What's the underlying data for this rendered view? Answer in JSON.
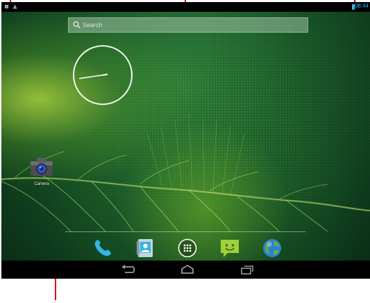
{
  "status_bar": {
    "time": "08:44",
    "colors": {
      "accent": "#33b5e5"
    }
  },
  "search": {
    "placeholder": "Search"
  },
  "clock": {
    "time_shown": "8:44"
  },
  "desktop_icons": [
    {
      "label": "Camera",
      "icon": "camera-icon"
    }
  ],
  "dock": [
    {
      "icon": "phone-icon"
    },
    {
      "icon": "contacts-icon"
    },
    {
      "icon": "app-drawer-icon"
    },
    {
      "icon": "messaging-icon"
    },
    {
      "icon": "browser-icon"
    }
  ],
  "nav_bar": [
    {
      "icon": "back-icon"
    },
    {
      "icon": "home-icon"
    },
    {
      "icon": "recent-apps-icon"
    }
  ],
  "callouts": {
    "color": "#e0001b"
  }
}
